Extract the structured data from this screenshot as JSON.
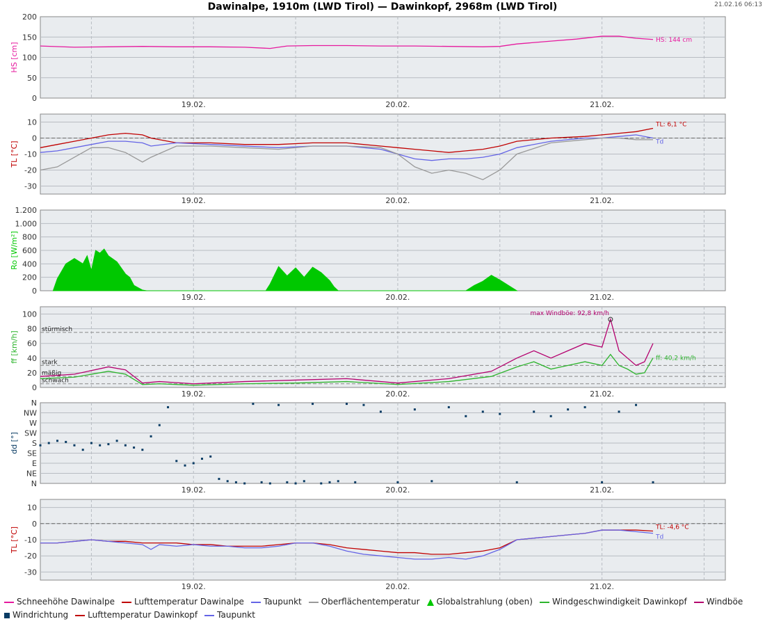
{
  "title": "Dawinalpe, 1910m (LWD Tirol) — Dawinkopf, 2968m (LWD Tirol)",
  "timestamp": "21.02.16 06:13",
  "x_axis": {
    "range_hours": [
      0,
      80.5
    ],
    "tick_labels": [
      "19.02.",
      "20.02.",
      "21.02."
    ],
    "tick_hours": [
      18,
      42,
      66
    ],
    "minor_grid_hours": [
      6,
      18,
      30,
      42,
      54,
      66,
      78
    ]
  },
  "colors": {
    "snow_depth": "#e6199e",
    "air_temp": "#c00000",
    "dewpoint": "#6464e6",
    "surface_temp": "#999999",
    "radiation": "#00c800",
    "wind_speed": "#2db42d",
    "wind_gust": "#b4006e",
    "wind_dir": "#0a3c64",
    "panel_bg": "#e9ecef"
  },
  "chart_data": [
    {
      "id": "snow",
      "type": "line",
      "ylabel": "HS [cm]",
      "ylim": [
        0,
        200
      ],
      "yticks": [
        0,
        50,
        100,
        150,
        200
      ],
      "grid": true,
      "series": [
        {
          "name": "Schneehöhe Dawinalpe",
          "color_key": "snow_depth",
          "x": [
            0,
            4,
            8,
            12,
            16,
            20,
            24,
            27,
            29,
            32,
            36,
            40,
            44,
            48,
            52,
            54,
            56,
            60,
            63,
            66,
            68,
            70,
            72
          ],
          "y": [
            128,
            125,
            126,
            127,
            126,
            126,
            125,
            122,
            128,
            129,
            129,
            128,
            128,
            127,
            126,
            127,
            133,
            140,
            145,
            152,
            152,
            147,
            144
          ]
        }
      ],
      "annotation": {
        "text": "HS: 144 cm",
        "color_key": "snow_depth"
      }
    },
    {
      "id": "temp1",
      "type": "line",
      "ylabel": "TL [°C]",
      "ylim": [
        -35,
        15
      ],
      "yticks": [
        -30,
        -20,
        -10,
        0,
        10
      ],
      "grid": true,
      "zero_line": true,
      "series": [
        {
          "name": "Lufttemperatur Dawinalpe",
          "color_key": "air_temp",
          "x": [
            0,
            2,
            4,
            6,
            8,
            10,
            12,
            13,
            16,
            20,
            24,
            28,
            32,
            36,
            40,
            42,
            44,
            46,
            48,
            50,
            52,
            54,
            56,
            60,
            64,
            66,
            68,
            70,
            72
          ],
          "y": [
            -6,
            -4,
            -2,
            0,
            2,
            3,
            2,
            0,
            -3,
            -3,
            -4,
            -4,
            -3,
            -3,
            -5,
            -6,
            -7,
            -8,
            -9,
            -8,
            -7,
            -5,
            -2,
            0,
            1,
            2,
            3,
            4,
            6.1
          ]
        },
        {
          "name": "Taupunkt",
          "color_key": "dewpoint",
          "x": [
            0,
            2,
            4,
            6,
            8,
            10,
            12,
            13,
            16,
            20,
            24,
            28,
            32,
            36,
            40,
            42,
            44,
            46,
            48,
            50,
            52,
            54,
            56,
            60,
            64,
            66,
            68,
            70,
            72
          ],
          "y": [
            -9,
            -8,
            -6,
            -4,
            -2,
            -2,
            -3,
            -5,
            -3,
            -4,
            -5,
            -6,
            -5,
            -5,
            -7,
            -10,
            -13,
            -14,
            -13,
            -13,
            -12,
            -10,
            -6,
            -2,
            0,
            0,
            1,
            2,
            0
          ]
        },
        {
          "name": "Oberflächentemperatur",
          "color_key": "surface_temp",
          "x": [
            0,
            2,
            4,
            6,
            8,
            10,
            12,
            13,
            16,
            20,
            24,
            28,
            32,
            36,
            40,
            42,
            44,
            46,
            48,
            50,
            52,
            54,
            56,
            60,
            64,
            66,
            68,
            70,
            72
          ],
          "y": [
            -20,
            -18,
            -12,
            -6,
            -6,
            -9,
            -15,
            -12,
            -5,
            -5,
            -6,
            -7,
            -5,
            -5,
            -6,
            -10,
            -18,
            -22,
            -20,
            -22,
            -26,
            -20,
            -10,
            -3,
            -1,
            0,
            0,
            -1,
            -1
          ]
        }
      ],
      "labels": [
        {
          "text": "TL: 6,1 °C",
          "color_key": "air_temp"
        },
        {
          "text": "Td",
          "color_key": "dewpoint"
        }
      ]
    },
    {
      "id": "radiation",
      "type": "area",
      "ylabel": "Ro [W/m²]",
      "ylim": [
        0,
        1200
      ],
      "ytick_labels": [
        "0",
        "200",
        "400",
        "600",
        "800",
        "1.000",
        "1.200"
      ],
      "yticks": [
        0,
        200,
        400,
        600,
        800,
        1000,
        1200
      ],
      "grid": true,
      "series": [
        {
          "name": "Globalstrahlung (oben)",
          "color_key": "radiation",
          "x": [
            1.5,
            2,
            3,
            4,
            5,
            5.5,
            6,
            6.5,
            7,
            7.5,
            8,
            9,
            10,
            10.5,
            11,
            12,
            12.5,
            26.5,
            27,
            28,
            29,
            30,
            31,
            32,
            33,
            34,
            34.5,
            35,
            50,
            51,
            52,
            53,
            54,
            55,
            56
          ],
          "y": [
            0,
            180,
            400,
            480,
            400,
            520,
            300,
            600,
            560,
            620,
            520,
            430,
            250,
            200,
            80,
            10,
            0,
            0,
            100,
            360,
            220,
            340,
            200,
            350,
            270,
            150,
            60,
            0,
            0,
            80,
            140,
            230,
            160,
            80,
            0
          ]
        }
      ]
    },
    {
      "id": "wind",
      "type": "line",
      "ylabel": "ff [km/h]",
      "ylim": [
        0,
        110
      ],
      "yticks": [
        0,
        20,
        40,
        60,
        80,
        100
      ],
      "grid": true,
      "threshold_lines": [
        {
          "text": "stürmisch",
          "value": 75
        },
        {
          "text": "stark",
          "value": 30
        },
        {
          "text": "mäßig",
          "value": 15
        },
        {
          "text": "schwach",
          "value": 5
        }
      ],
      "series": [
        {
          "name": "Windgeschwindigkeit Dawinkopf",
          "color_key": "wind_speed",
          "x": [
            0,
            4,
            8,
            10,
            12,
            14,
            18,
            24,
            30,
            36,
            42,
            48,
            53,
            56,
            58,
            60,
            62,
            64,
            66,
            67,
            68,
            69,
            70,
            71,
            72
          ],
          "y": [
            12,
            14,
            22,
            18,
            4,
            5,
            3,
            5,
            6,
            8,
            4,
            8,
            15,
            28,
            35,
            25,
            30,
            35,
            30,
            45,
            30,
            25,
            18,
            20,
            40.2
          ]
        },
        {
          "name": "Windböe",
          "color_key": "wind_gust",
          "x": [
            0,
            4,
            8,
            10,
            12,
            14,
            18,
            24,
            30,
            36,
            42,
            48,
            53,
            56,
            58,
            60,
            62,
            64,
            66,
            67,
            68,
            69,
            70,
            71,
            72
          ],
          "y": [
            15,
            18,
            28,
            24,
            6,
            8,
            5,
            8,
            10,
            12,
            6,
            12,
            22,
            40,
            50,
            40,
            50,
            60,
            55,
            92.8,
            50,
            40,
            30,
            35,
            60
          ]
        }
      ],
      "annotations": [
        {
          "text": "max Windböe: 92,8 km/h",
          "color_key": "wind_gust",
          "x": 67,
          "y": 92.8
        },
        {
          "text": "ff: 40,2 km/h",
          "color_key": "wind_speed"
        }
      ]
    },
    {
      "id": "winddir",
      "type": "scatter",
      "ylabel": "dd [°]",
      "ylim": [
        0,
        360
      ],
      "ytick_labels": [
        "N",
        "NE",
        "E",
        "SE",
        "S",
        "SW",
        "W",
        "NW",
        "N"
      ],
      "yticks": [
        0,
        45,
        90,
        135,
        180,
        225,
        270,
        315,
        360
      ],
      "grid": true,
      "series": [
        {
          "name": "Windrichtung",
          "color_key": "wind_dir",
          "x": [
            0,
            1,
            2,
            3,
            4,
            5,
            6,
            7,
            8,
            9,
            10,
            11,
            12,
            13,
            14,
            15,
            16,
            17,
            18,
            19,
            20,
            21,
            22,
            23,
            24,
            25,
            26,
            27,
            28,
            29,
            30,
            31,
            32,
            33,
            34,
            35,
            36,
            37,
            38,
            40,
            42,
            44,
            46,
            48,
            50,
            52,
            54,
            56,
            58,
            60,
            62,
            64,
            66,
            68,
            70,
            72
          ],
          "y": [
            170,
            180,
            190,
            185,
            170,
            150,
            180,
            170,
            175,
            190,
            170,
            160,
            150,
            210,
            260,
            340,
            100,
            80,
            90,
            110,
            120,
            20,
            10,
            5,
            0,
            355,
            5,
            0,
            350,
            5,
            0,
            10,
            355,
            0,
            5,
            10,
            355,
            5,
            350,
            320,
            5,
            330,
            10,
            340,
            300,
            320,
            310,
            5,
            320,
            300,
            330,
            340,
            5,
            320,
            350,
            5
          ]
        }
      ]
    },
    {
      "id": "temp2",
      "type": "line",
      "ylabel": "TL [°C]",
      "ylim": [
        -35,
        15
      ],
      "yticks": [
        -30,
        -20,
        -10,
        0,
        10
      ],
      "grid": true,
      "zero_line": true,
      "series": [
        {
          "name": "Lufttemperatur Dawinkopf",
          "color_key": "air_temp",
          "x": [
            0,
            2,
            4,
            6,
            8,
            10,
            12,
            14,
            16,
            18,
            20,
            22,
            24,
            26,
            28,
            30,
            32,
            34,
            36,
            38,
            40,
            42,
            44,
            46,
            48,
            50,
            52,
            54,
            56,
            58,
            60,
            62,
            64,
            66,
            68,
            70,
            72
          ],
          "y": [
            -12,
            -12,
            -11,
            -10,
            -11,
            -11,
            -12,
            -12,
            -12,
            -13,
            -13,
            -14,
            -14,
            -14,
            -13,
            -12,
            -12,
            -13,
            -15,
            -16,
            -17,
            -18,
            -18,
            -19,
            -19,
            -18,
            -17,
            -15,
            -10,
            -9,
            -8,
            -7,
            -6,
            -4,
            -4,
            -4,
            -4.6
          ]
        },
        {
          "name": "Taupunkt",
          "color_key": "dewpoint",
          "x": [
            0,
            2,
            4,
            6,
            8,
            10,
            12,
            13,
            14,
            16,
            18,
            20,
            22,
            24,
            26,
            28,
            30,
            32,
            34,
            36,
            38,
            40,
            42,
            44,
            46,
            48,
            50,
            52,
            54,
            56,
            58,
            60,
            62,
            64,
            66,
            68,
            70,
            72
          ],
          "y": [
            -12,
            -12,
            -11,
            -10,
            -11,
            -12,
            -13,
            -16,
            -13,
            -14,
            -13,
            -14,
            -14,
            -15,
            -15,
            -14,
            -12,
            -12,
            -14,
            -17,
            -19,
            -20,
            -21,
            -22,
            -22,
            -21,
            -22,
            -20,
            -16,
            -10,
            -9,
            -8,
            -7,
            -6,
            -4,
            -4,
            -5,
            -6
          ]
        }
      ],
      "labels": [
        {
          "text": "TL: -4,6 °C",
          "color_key": "air_temp"
        },
        {
          "text": "Td",
          "color_key": "dewpoint"
        }
      ]
    }
  ],
  "legend": [
    {
      "label": "Schneehöhe Dawinalpe",
      "color_key": "snow_depth",
      "symbol": "line"
    },
    {
      "label": "Lufttemperatur Dawinalpe",
      "color_key": "air_temp",
      "symbol": "line"
    },
    {
      "label": "Taupunkt",
      "color_key": "dewpoint",
      "symbol": "line"
    },
    {
      "label": "Oberflächentemperatur",
      "color_key": "surface_temp",
      "symbol": "line"
    },
    {
      "label": "Globalstrahlung (oben)",
      "color_key": "radiation",
      "symbol": "triangle"
    },
    {
      "label": "Windgeschwindigkeit Dawinkopf",
      "color_key": "wind_speed",
      "symbol": "line"
    },
    {
      "label": "Windböe",
      "color_key": "wind_gust",
      "symbol": "line"
    },
    {
      "label": "Windrichtung",
      "color_key": "wind_dir",
      "symbol": "square"
    },
    {
      "label": "Lufttemperatur Dawinkopf",
      "color_key": "air_temp",
      "symbol": "line"
    },
    {
      "label": "Taupunkt",
      "color_key": "dewpoint",
      "symbol": "line"
    }
  ]
}
